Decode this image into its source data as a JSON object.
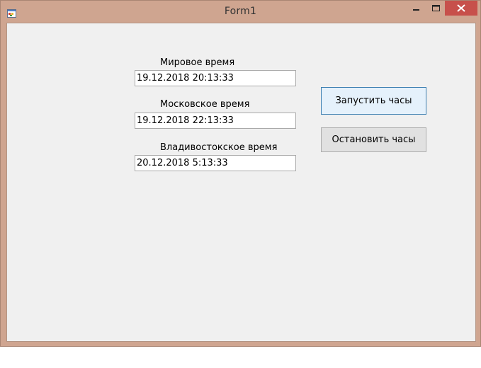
{
  "window": {
    "title": "Form1"
  },
  "form": {
    "fields": [
      {
        "label": "Мировое время",
        "value": "19.12.2018 20:13:33"
      },
      {
        "label": "Московское время",
        "value": "19.12.2018 22:13:33"
      },
      {
        "label": "Владивостокское время",
        "value": "20.12.2018 5:13:33"
      }
    ],
    "start_button_label": "Запустить часы",
    "stop_button_label": "Остановить часы"
  }
}
